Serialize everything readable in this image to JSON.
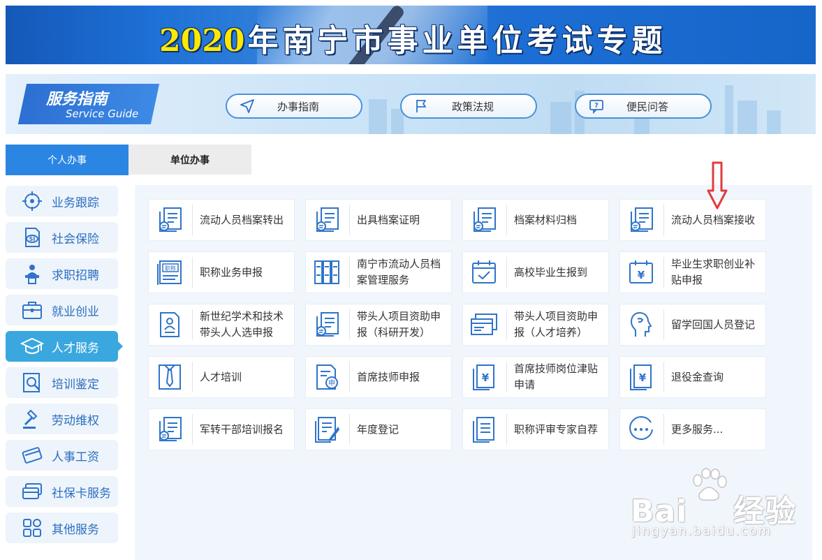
{
  "banner": {
    "year": "2020",
    "title": "年南宁市事业单位考试专题"
  },
  "guide": {
    "title_zh": "服务指南",
    "title_en": "Service Guide",
    "pills": [
      {
        "label": "办事指南",
        "icon": "navigation-arrow-icon"
      },
      {
        "label": "政策法规",
        "icon": "flag-icon"
      },
      {
        "label": "便民问答",
        "icon": "question-chat-icon"
      }
    ]
  },
  "tabs": {
    "active": "个人办事",
    "inactive": "单位办事"
  },
  "sidebar": {
    "items": [
      {
        "label": "业务跟踪",
        "icon": "crosshair-icon"
      },
      {
        "label": "社会保险",
        "icon": "social-insurance-icon"
      },
      {
        "label": "求职招聘",
        "icon": "presenter-icon"
      },
      {
        "label": "就业创业",
        "icon": "briefcase-icon"
      },
      {
        "label": "人才服务",
        "icon": "graduation-cap-icon"
      },
      {
        "label": "培训鉴定",
        "icon": "search-document-icon"
      },
      {
        "label": "劳动维权",
        "icon": "gavel-icon"
      },
      {
        "label": "人事工资",
        "icon": "credit-card-icon"
      },
      {
        "label": "社保卡服务",
        "icon": "card-stack-icon"
      },
      {
        "label": "其他服务",
        "icon": "grid-icon"
      }
    ],
    "active_index": 4
  },
  "services": {
    "rows": [
      [
        {
          "label": "流动人员档案转出",
          "icon": "document-search-icon"
        },
        {
          "label": "出具档案证明",
          "icon": "document-search-icon"
        },
        {
          "label": "档案材料归档",
          "icon": "document-search-icon"
        },
        {
          "label": "流动人员档案接收",
          "icon": "document-search-icon"
        }
      ],
      [
        {
          "label": "职称业务申报",
          "icon": "title-certificate-icon"
        },
        {
          "label": "南宁市流动人员档案管理服务",
          "icon": "binders-icon"
        },
        {
          "label": "高校毕业生报到",
          "icon": "calendar-check-icon"
        },
        {
          "label": "毕业生求职创业补贴申报",
          "icon": "calendar-yen-icon"
        }
      ],
      [
        {
          "label": "新世纪学术和技术带头人人选申报",
          "icon": "id-badge-icon"
        },
        {
          "label": "带头人项目资助申报（科研开发）",
          "icon": "document-search-icon"
        },
        {
          "label": "带头人项目资助申报（人才培养）",
          "icon": "browser-windows-icon"
        },
        {
          "label": "留学回国人员登记",
          "icon": "head-profile-icon"
        }
      ],
      [
        {
          "label": "人才培训",
          "icon": "necktie-icon"
        },
        {
          "label": "首席技师申报",
          "icon": "apply-document-icon"
        },
        {
          "label": "首席技师岗位津贴申请",
          "icon": "yen-document-icon"
        },
        {
          "label": "退役金查询",
          "icon": "yen-document-icon"
        }
      ],
      [
        {
          "label": "军转干部培训报名",
          "icon": "document-search-icon"
        },
        {
          "label": "年度登记",
          "icon": "edit-document-icon"
        },
        {
          "label": "职称评审专家自荐",
          "icon": "list-document-icon"
        },
        {
          "label": "更多服务...",
          "icon": "more-dots-icon"
        }
      ]
    ]
  },
  "watermark": {
    "brand": "Bai",
    "brand_suffix": "经验",
    "url": "jingyan.baidu.com"
  },
  "colors": {
    "primary": "#2b86e3",
    "active_side": "#3aa7df",
    "icon_blue": "#2f74c9",
    "arrow_red": "#e23b3b"
  }
}
